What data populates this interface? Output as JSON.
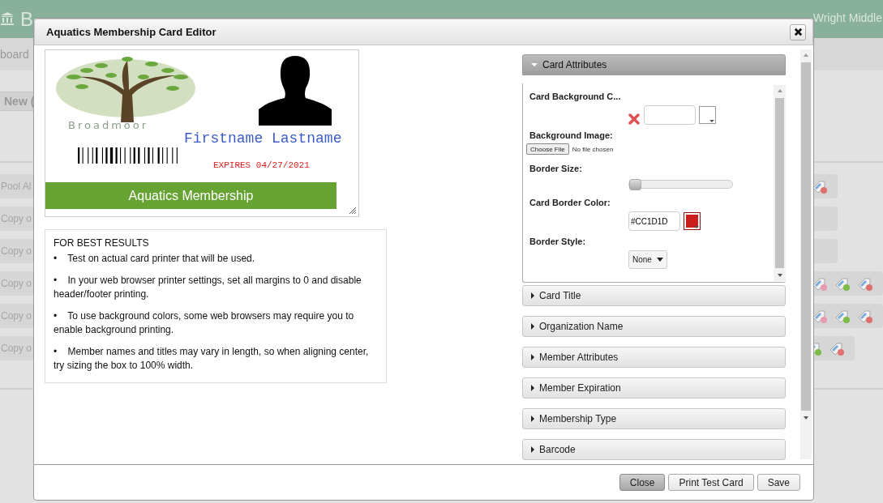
{
  "header": {
    "title": "B",
    "location": "Wright Middle"
  },
  "background": {
    "breadcrumb": "board",
    "new_button": "New (",
    "rows": [
      {
        "label": "Pool Al",
        "edit": false,
        "add": false,
        "remove": true
      },
      {
        "label": "Copy o",
        "edit": false,
        "add": false,
        "remove": false
      },
      {
        "label": "Copy o",
        "edit": false,
        "add": false,
        "remove": false
      },
      {
        "label": "Copy o",
        "edit": true,
        "add": true,
        "remove": true
      },
      {
        "label": "Copy o",
        "edit": true,
        "add": true,
        "remove": true
      },
      {
        "label": "Copy o",
        "edit": false,
        "add": true,
        "remove": true
      }
    ]
  },
  "dialog": {
    "title": "Aquatics Membership Card Editor",
    "card": {
      "logo_text": "Broadmoor",
      "name": "Firstname Lastname",
      "expires": "EXPIRES 04/27/2021",
      "membership": "Aquatics Membership"
    },
    "tips": {
      "heading": "FOR BEST RESULTS",
      "items": [
        "•    Test on actual card printer that will be used.",
        "•    In your web browser printer settings, set all margins to 0 and disable header/footer printing.",
        "•    To use background colors, some web browsers may require you to enable background printing.",
        "•    Member names and titles may vary in length, so when aligning center, try sizing the box to 100% width."
      ]
    },
    "sections": [
      {
        "title": "Card Attributes",
        "expanded": true
      },
      {
        "title": "Card Title",
        "expanded": false
      },
      {
        "title": "Organization Name",
        "expanded": false
      },
      {
        "title": "Member Attributes",
        "expanded": false
      },
      {
        "title": "Member Expiration",
        "expanded": false
      },
      {
        "title": "Membership Type",
        "expanded": false
      },
      {
        "title": "Barcode",
        "expanded": false
      }
    ],
    "fields": [
      {
        "kind": "color",
        "label": "Card Background C...",
        "color": "#ffffff"
      },
      {
        "kind": "file",
        "label": "Background Image:",
        "button": "Choose File",
        "status": "No file chosen"
      },
      {
        "kind": "slider",
        "label": "Border Size:",
        "level": 0
      },
      {
        "kind": "color",
        "label": "Card Border Color:",
        "value": "#CC1D1D",
        "color": "#cc1d1d"
      },
      {
        "kind": "select",
        "label": "Border Style:",
        "value": "None"
      }
    ],
    "buttons": [
      {
        "label": "Close",
        "pressed": true
      },
      {
        "label": "Print Test Card",
        "pressed": false
      },
      {
        "label": "Save",
        "pressed": false
      }
    ]
  }
}
